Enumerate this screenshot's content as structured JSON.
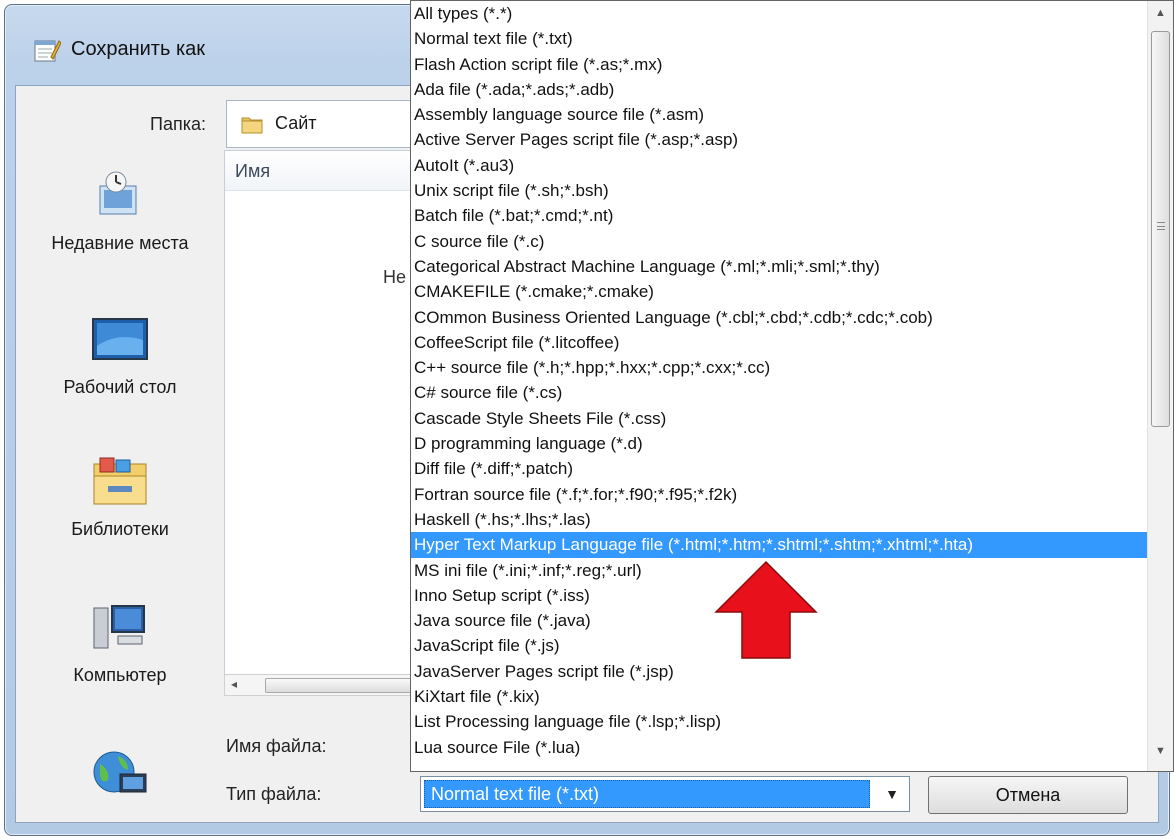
{
  "window": {
    "title": "Сохранить как"
  },
  "folder": {
    "label": "Папка:",
    "value": "Сайт"
  },
  "places": [
    {
      "label": "Недавние места",
      "icon": "recent-places-icon"
    },
    {
      "label": "Рабочий стол",
      "icon": "desktop-icon"
    },
    {
      "label": "Библиотеки",
      "icon": "libraries-icon"
    },
    {
      "label": "Компьютер",
      "icon": "computer-icon"
    },
    {
      "label": "",
      "icon": "network-icon"
    }
  ],
  "file_list": {
    "column_name": "Имя",
    "empty_text": "Не"
  },
  "fields": {
    "filename_label": "Имя файла:",
    "filetype_label": "Тип файла:",
    "filetype_value": "Normal text file (*.txt)"
  },
  "buttons": {
    "cancel": "Отмена"
  },
  "dropdown": {
    "selected_index": 21,
    "items": [
      "All types (*.*)",
      "Normal text file (*.txt)",
      "Flash Action script file (*.as;*.mx)",
      "Ada file (*.ada;*.ads;*.adb)",
      "Assembly language source file (*.asm)",
      "Active Server Pages script file (*.asp;*.asp)",
      "AutoIt (*.au3)",
      "Unix script file (*.sh;*.bsh)",
      "Batch file (*.bat;*.cmd;*.nt)",
      "C source file (*.c)",
      "Categorical Abstract Machine Language (*.ml;*.mli;*.sml;*.thy)",
      "CMAKEFILE (*.cmake;*.cmake)",
      "COmmon Business Oriented Language (*.cbl;*.cbd;*.cdb;*.cdc;*.cob)",
      "CoffeeScript file (*.litcoffee)",
      "C++ source file (*.h;*.hpp;*.hxx;*.cpp;*.cxx;*.cc)",
      "C# source file (*.cs)",
      "Cascade Style Sheets File (*.css)",
      "D programming language (*.d)",
      "Diff file (*.diff;*.patch)",
      "Fortran source file (*.f;*.for;*.f90;*.f95;*.f2k)",
      "Haskell (*.hs;*.lhs;*.las)",
      "Hyper Text Markup Language file (*.html;*.htm;*.shtml;*.shtm;*.xhtml;*.hta)",
      "MS ini file (*.ini;*.inf;*.reg;*.url)",
      "Inno Setup script (*.iss)",
      "Java source file (*.java)",
      "JavaScript file (*.js)",
      "JavaServer Pages script file (*.jsp)",
      "KiXtart file (*.kix)",
      "List Processing language file (*.lsp;*.lisp)",
      "Lua source File (*.lua)"
    ]
  },
  "colors": {
    "selection": "#3399ff",
    "annotation_arrow": "#e8101a"
  }
}
